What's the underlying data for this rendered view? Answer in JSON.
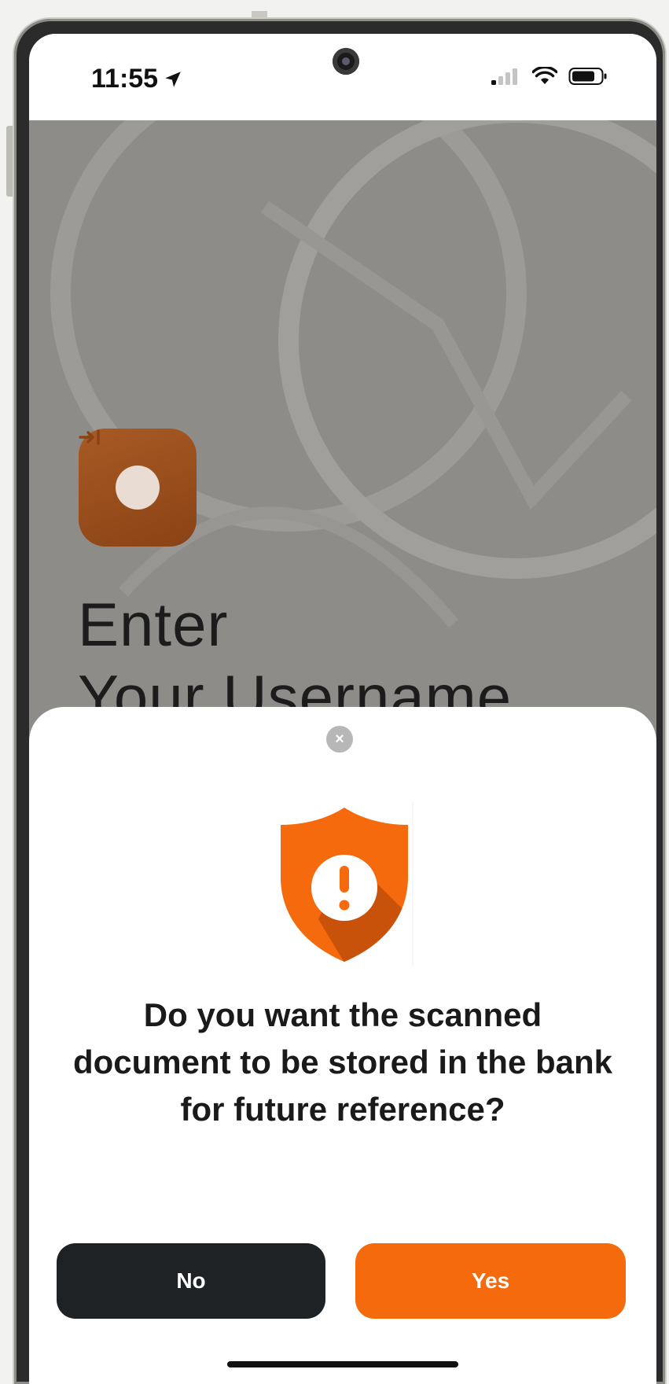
{
  "status_bar": {
    "time": "11:55",
    "icons": [
      "location-arrow-icon",
      "cellular-signal-icon",
      "wifi-icon",
      "battery-icon"
    ]
  },
  "background_screen": {
    "app_icon": "sign-in-arrow-icon",
    "title": "Enter\nYour Username"
  },
  "dialog": {
    "close_icon": "close-icon",
    "illustration": "shield-warning-icon",
    "question": "Do you want the scanned document to be stored in the bank for future reference?",
    "no_label": "No",
    "yes_label": "Yes"
  },
  "colors": {
    "accent": "#f56a0c",
    "dark_button": "#1f2224",
    "overlay": "#8d8c89"
  }
}
